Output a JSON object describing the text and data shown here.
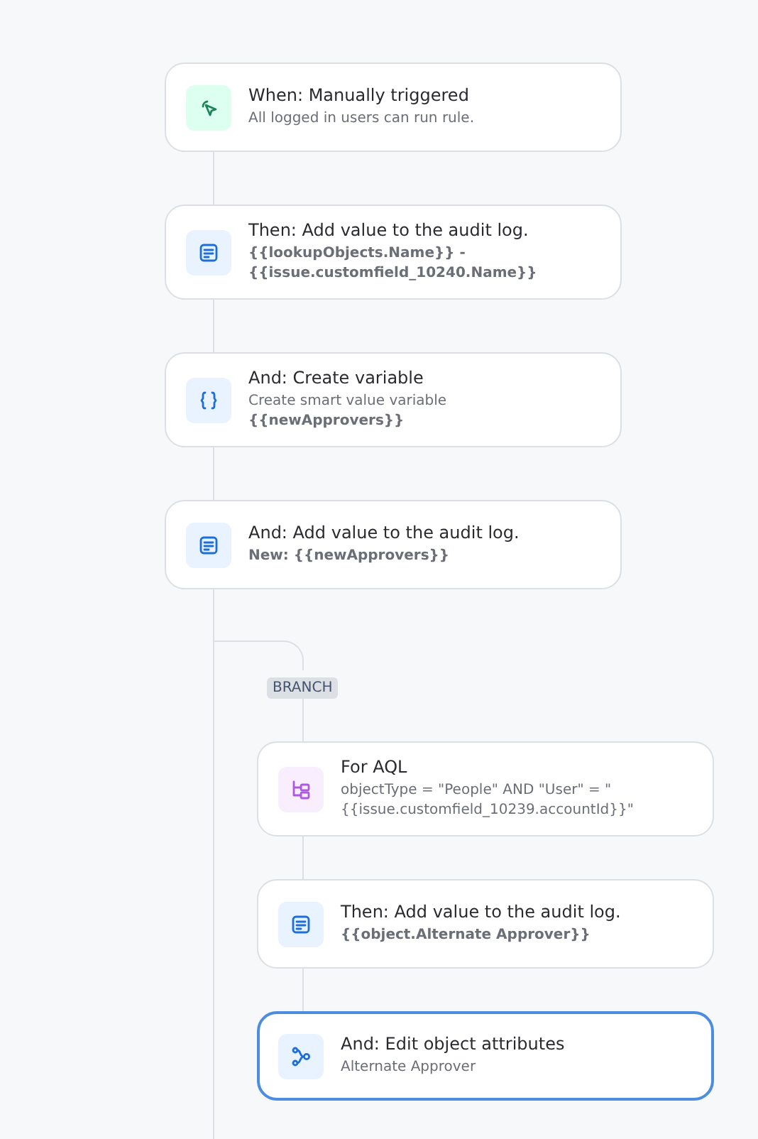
{
  "steps": [
    {
      "kind": "trigger",
      "title": "When: Manually triggered",
      "lines": [
        {
          "text": "All logged in users can run rule.",
          "bold": false
        }
      ],
      "selected": false
    },
    {
      "kind": "log",
      "title": "Then: Add value to the audit log.",
      "lines": [
        {
          "text": "{{lookupObjects.Name}} -",
          "bold": true
        },
        {
          "text": "{{issue.customfield_10240.Name}}",
          "bold": true
        }
      ],
      "selected": false
    },
    {
      "kind": "variable",
      "title": "And: Create variable",
      "lines": [
        {
          "text": "Create smart value variable",
          "bold": false
        },
        {
          "text": "{{newApprovers}}",
          "bold": true
        }
      ],
      "selected": false
    },
    {
      "kind": "log",
      "title": "And: Add value to the audit log.",
      "lines": [
        {
          "text": "New: {{newApprovers}}",
          "bold": true
        }
      ],
      "selected": false
    }
  ],
  "branch": {
    "label": "BRANCH",
    "steps": [
      {
        "kind": "branch",
        "title": "For AQL",
        "lines": [
          {
            "text": "objectType = \"People\" AND \"User\" = \"",
            "bold": false
          },
          {
            "text": "{{issue.customfield_10239.accountId}}\"",
            "bold": false
          }
        ],
        "selected": false
      },
      {
        "kind": "log",
        "title": "Then: Add value to the audit log.",
        "lines": [
          {
            "text": "{{object.Alternate Approver}}",
            "bold": true
          }
        ],
        "selected": false
      },
      {
        "kind": "edit",
        "title": "And: Edit object attributes",
        "lines": [
          {
            "text": "Alternate Approver",
            "bold": false
          }
        ],
        "selected": true
      }
    ]
  }
}
